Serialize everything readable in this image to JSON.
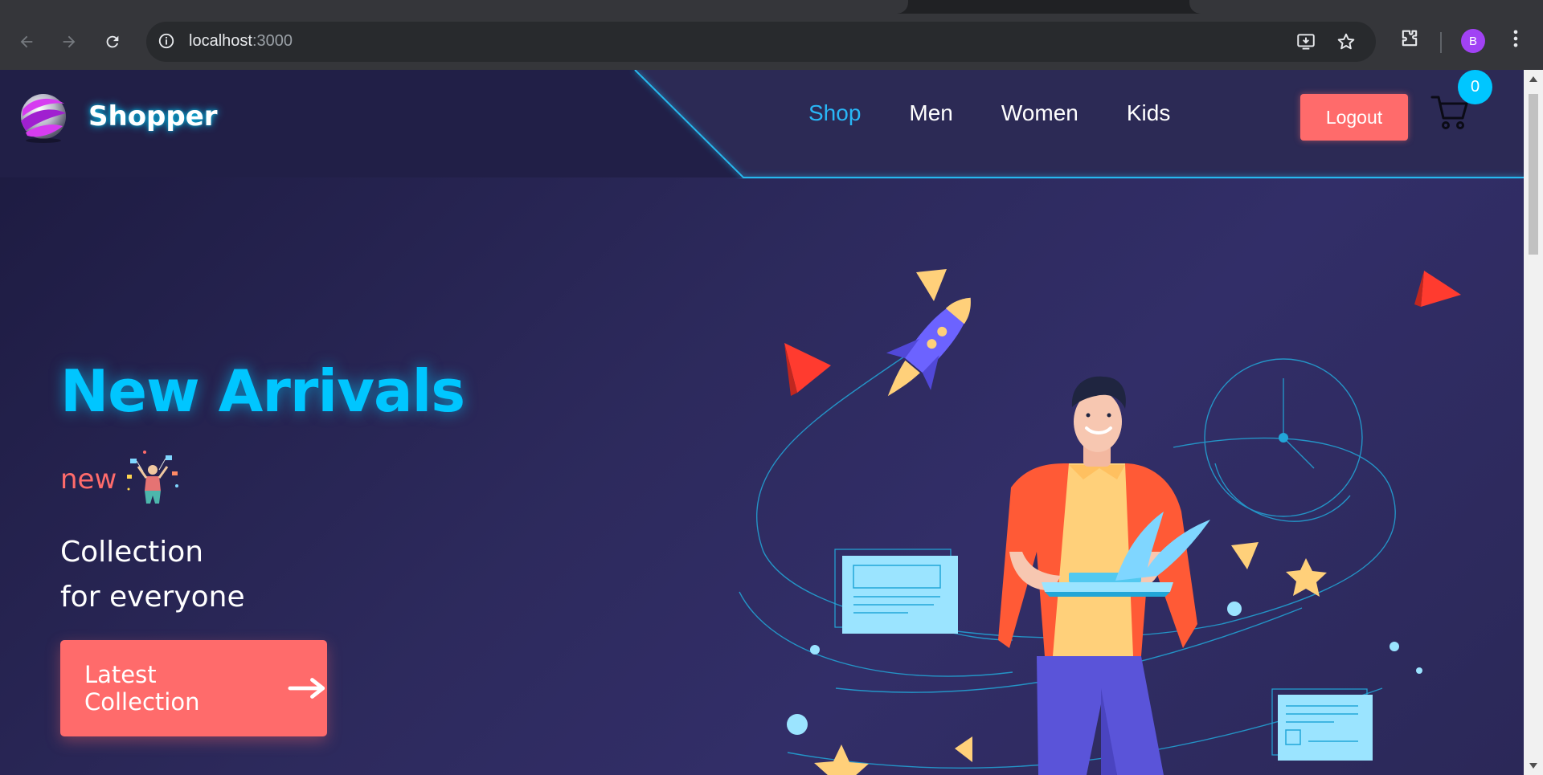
{
  "browser": {
    "url_host": "localhost",
    "url_port": ":3000",
    "profile_initial": "B",
    "icons": [
      "back-arrow-icon",
      "forward-arrow-icon",
      "reload-icon",
      "site-info-icon",
      "install-app-icon",
      "bookmark-star-icon",
      "extensions-icon",
      "chrome-menu-icon"
    ]
  },
  "navbar": {
    "brand": "Shopper",
    "menu": [
      {
        "label": "Shop",
        "active": true
      },
      {
        "label": "Men",
        "active": false
      },
      {
        "label": "Women",
        "active": false
      },
      {
        "label": "Kids",
        "active": false
      }
    ],
    "logout_label": "Logout",
    "cart_count": "0"
  },
  "hero": {
    "title": "New Arrivals",
    "new_label": "new",
    "line1": "Collection",
    "line2": "for everyone",
    "cta_label": "Latest Collection"
  },
  "colors": {
    "accent_cyan": "#00c6ff",
    "active_link": "#29b6f6",
    "coral": "#ff6b6b",
    "bg_dark": "#1c1a3f",
    "bg_mid": "#322e68"
  }
}
